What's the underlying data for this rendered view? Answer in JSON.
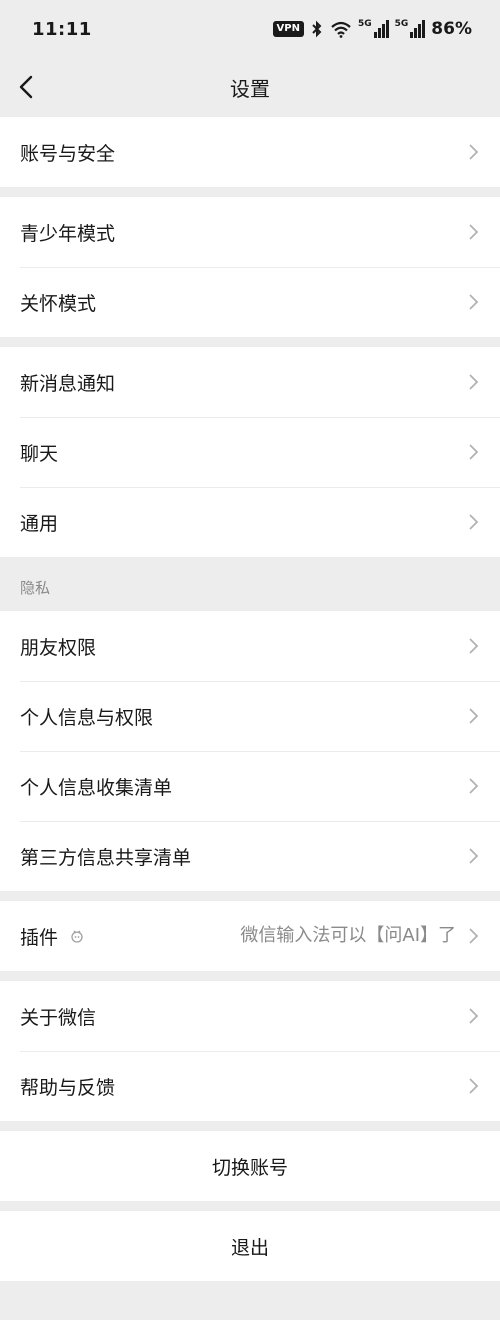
{
  "status_bar": {
    "time": "11:11",
    "vpn": "VPN",
    "net_label": "5G",
    "battery": "86%"
  },
  "nav": {
    "title": "设置"
  },
  "groups": {
    "account": [
      {
        "label": "账号与安全"
      }
    ],
    "modes": [
      {
        "label": "青少年模式"
      },
      {
        "label": "关怀模式"
      }
    ],
    "general": [
      {
        "label": "新消息通知"
      },
      {
        "label": "聊天"
      },
      {
        "label": "通用"
      }
    ],
    "privacy_title": "隐私",
    "privacy": [
      {
        "label": "朋友权限"
      },
      {
        "label": "个人信息与权限"
      },
      {
        "label": "个人信息收集清单"
      },
      {
        "label": "第三方信息共享清单"
      }
    ],
    "plugins": {
      "label": "插件",
      "value": "微信输入法可以【问AI】了"
    },
    "about": [
      {
        "label": "关于微信"
      },
      {
        "label": "帮助与反馈"
      }
    ],
    "switch_account": "切换账号",
    "logout": "退出"
  }
}
